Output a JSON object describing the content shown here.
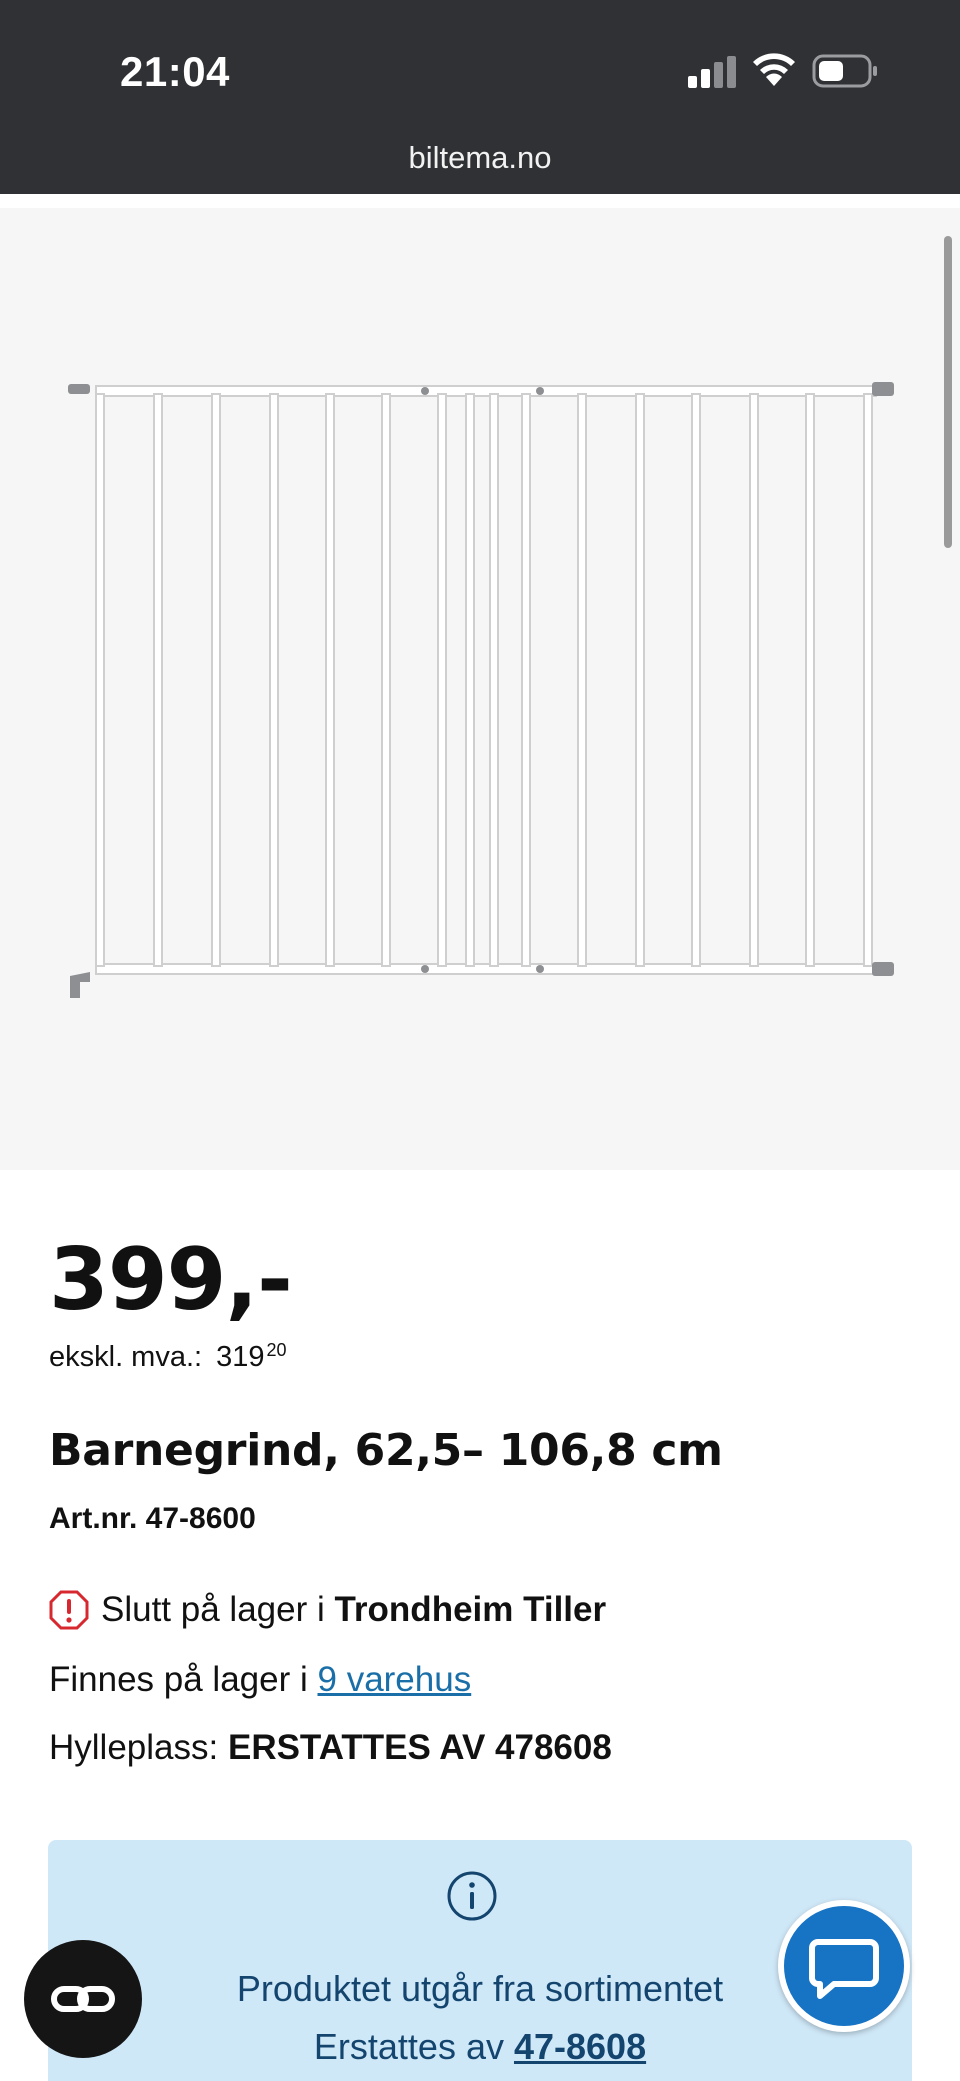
{
  "status_bar": {
    "time": "21:04",
    "icons": [
      "cellular-signal-icon",
      "wifi-icon",
      "battery-icon"
    ]
  },
  "browser": {
    "url": "biltema.no"
  },
  "product": {
    "image_alt": "baby-gate-icon",
    "price": "399,-",
    "ex_vat_label": "ekskl. mva.:",
    "ex_vat_main": "319",
    "ex_vat_cents": "20",
    "title": "Barnegrind, 62,5– 106,8 cm",
    "article_number": "Art.nr. 47-8600"
  },
  "stock": {
    "out_of_stock_prefix": "Slutt på lager i",
    "out_of_stock_store": "Trondheim Tiller",
    "available_prefix": "Finnes på lager i",
    "available_link": "9 varehus",
    "shelf_label": "Hylleplass:",
    "shelf_value": "ERSTATTES AV 478608"
  },
  "notice": {
    "line1": "Produktet utgår fra sortimentet",
    "line2_prefix": "Erstattes av",
    "line2_link": "47-8608"
  },
  "colors": {
    "status_bar_bg": "#2f3134",
    "notice_bg": "#cfe8f8",
    "notice_text": "#14456e",
    "link": "#1a6fa8",
    "alert": "#d8282f",
    "chat_button": "#1773c4"
  }
}
